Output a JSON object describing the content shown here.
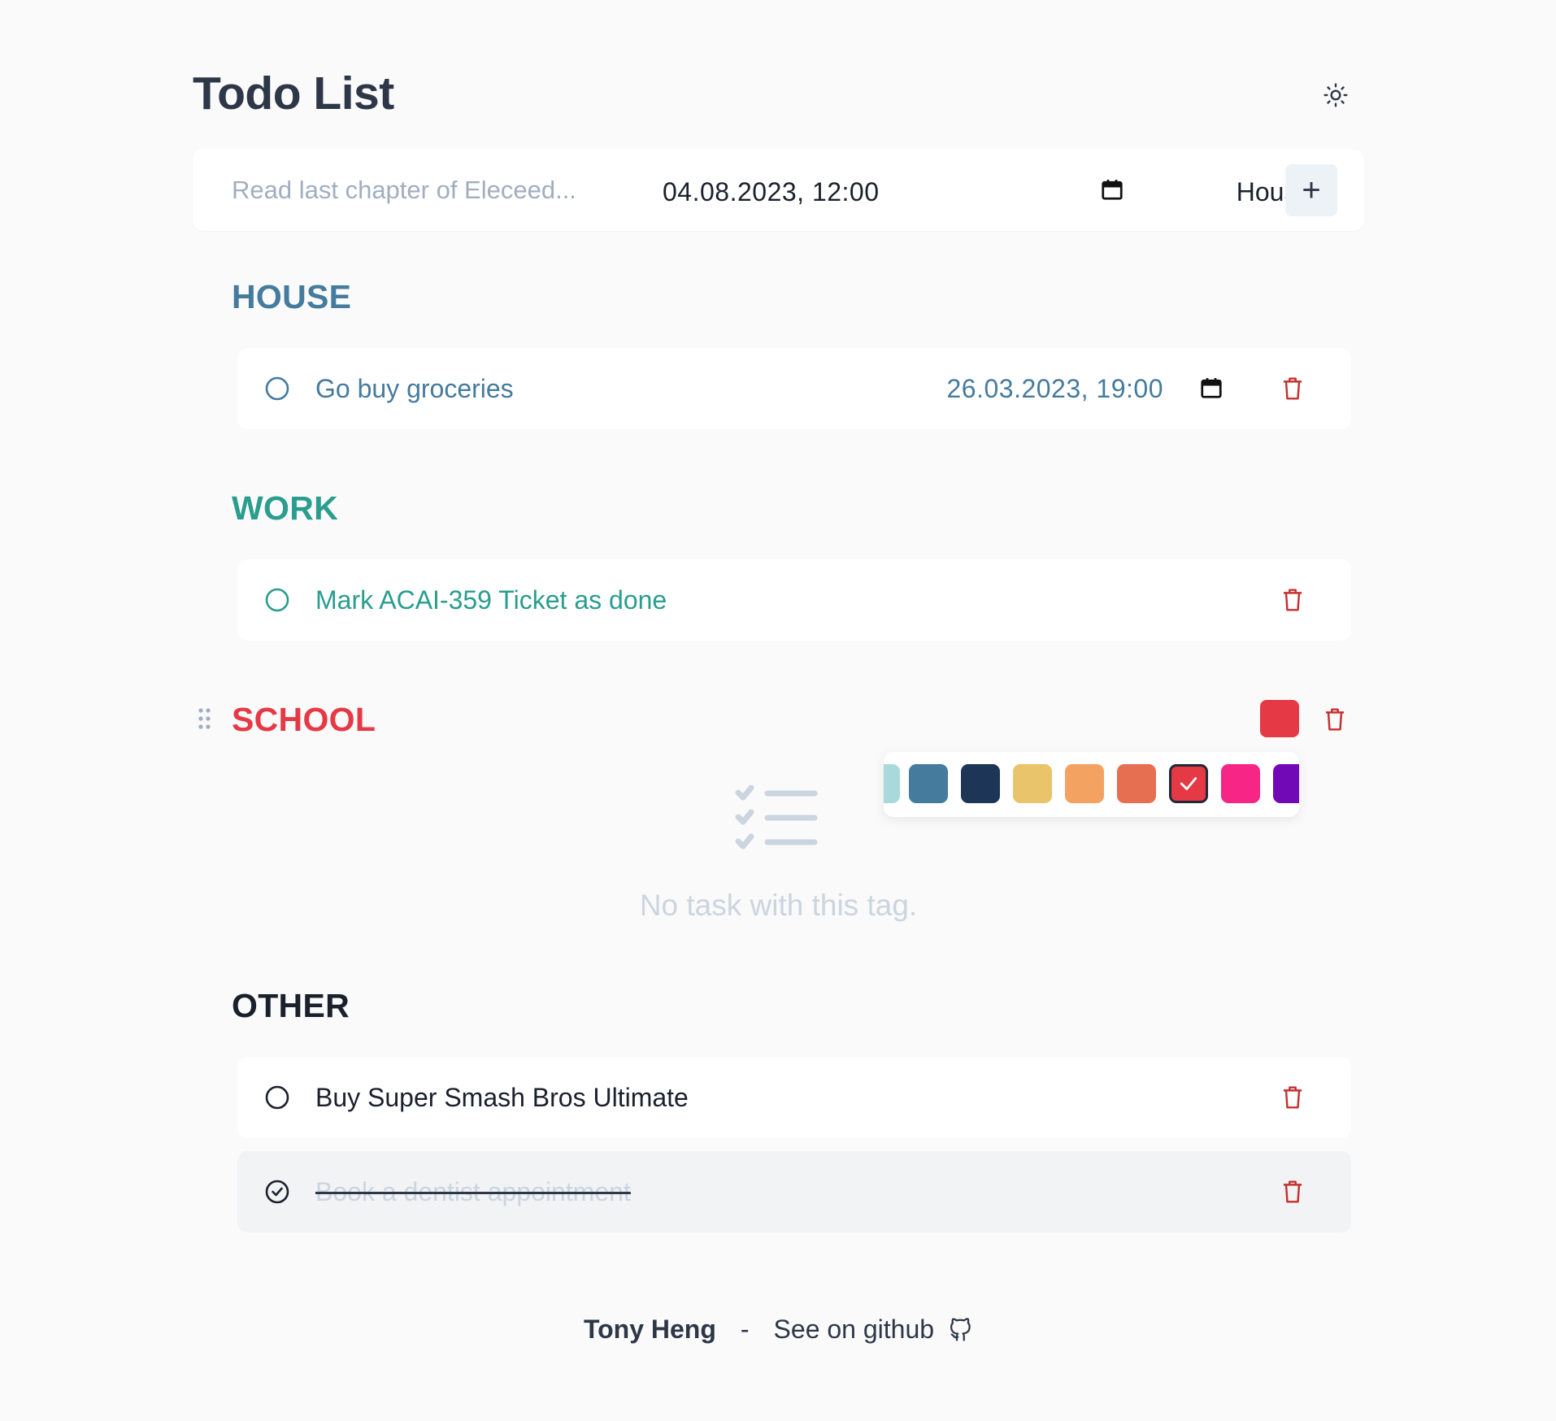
{
  "header": {
    "title": "Todo List",
    "theme_icon": "sun-icon"
  },
  "add_bar": {
    "placeholder": "Read last chapter of Eleceed...",
    "date_value": "04.08.2023, 12:00",
    "tag_value": "House",
    "add_label": "+"
  },
  "sections": {
    "house": {
      "title": "HOUSE",
      "color": "#457b9d",
      "tasks": [
        {
          "label": "Go buy groceries",
          "due": "26.03.2023, 19:00",
          "done": false
        }
      ]
    },
    "work": {
      "title": "WORK",
      "color": "#2a9d8f",
      "tasks": [
        {
          "label": "Mark ACAI-359 Ticket as done",
          "done": false
        }
      ]
    },
    "school": {
      "title": "SCHOOL",
      "color": "#e63946",
      "empty_text": "No task with this tag.",
      "palette": [
        "#a8dadc",
        "#457b9d",
        "#1d3557",
        "#e9c46a",
        "#f4a261",
        "#e76f51",
        "#e63946",
        "#f72585",
        "#7209b7"
      ],
      "selected_color": "#e63946"
    },
    "other": {
      "title": "OTHER",
      "color": "#1a202c",
      "tasks": [
        {
          "label": "Buy Super Smash Bros Ultimate",
          "done": false
        },
        {
          "label": "Book a dentist appointment",
          "done": true
        }
      ]
    }
  },
  "footer": {
    "author": "Tony Heng",
    "separator": "-",
    "link_text": "See on github",
    "link_icon": "github-icon"
  }
}
